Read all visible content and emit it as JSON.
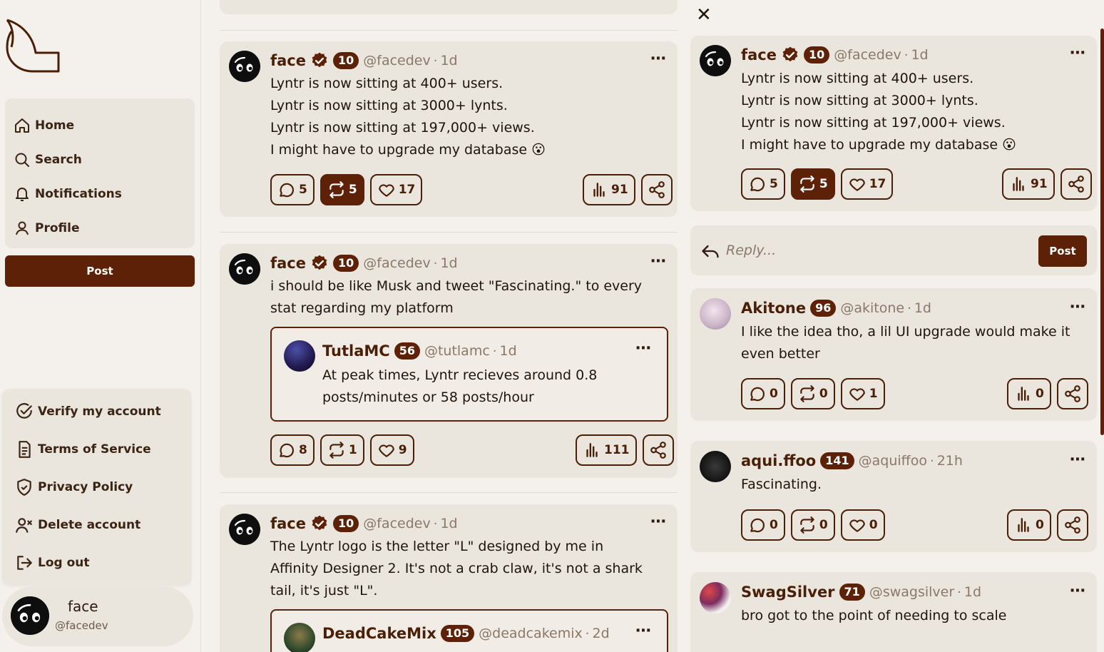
{
  "sidebar": {
    "nav": [
      {
        "label": "Home",
        "icon": "home-icon"
      },
      {
        "label": "Search",
        "icon": "search-icon"
      },
      {
        "label": "Notifications",
        "icon": "bell-icon"
      },
      {
        "label": "Profile",
        "icon": "user-icon"
      }
    ],
    "post_label": "Post",
    "menu": [
      {
        "label": "Verify my account",
        "icon": "verified-check-icon"
      },
      {
        "label": "Terms of Service",
        "icon": "document-icon"
      },
      {
        "label": "Privacy Policy",
        "icon": "shield-check-icon"
      },
      {
        "label": "Delete account",
        "icon": "user-remove-icon"
      },
      {
        "label": "Log out",
        "icon": "logout-icon"
      }
    ],
    "user": {
      "name": "face",
      "handle": "@facedev"
    }
  },
  "feed": {
    "posts": [
      {
        "name": "face",
        "verified": true,
        "level": "10",
        "handle": "@facedev",
        "time": "1d",
        "lines": [
          "Lyntr is now sitting at 400+ users.",
          "Lyntr is now sitting at 3000+ lynts.",
          "Lyntr is now sitting at 197,000+ views.",
          "I might have to upgrade my database 😮"
        ],
        "comments": "5",
        "reposts": "5",
        "likes": "17",
        "views": "91",
        "reposted": true
      },
      {
        "name": "face",
        "verified": true,
        "level": "10",
        "handle": "@facedev",
        "time": "1d",
        "lines": [
          "i should be like Musk and tweet \"Fascinating.\" to every",
          "stat regarding my platform"
        ],
        "quote": {
          "name": "TutlaMC",
          "level": "56",
          "handle": "@tutlamc",
          "time": "1d",
          "lines": [
            "At peak times, Lyntr recieves around 0.8",
            "posts/minutes or 58 posts/hour"
          ]
        },
        "comments": "8",
        "reposts": "1",
        "likes": "9",
        "views": "111"
      },
      {
        "name": "face",
        "verified": true,
        "level": "10",
        "handle": "@facedev",
        "time": "1d",
        "lines": [
          "The Lyntr logo is the letter \"L\" designed by me in",
          "Affinity Designer 2. It's not a crab claw, it's not a shark",
          "tail, it's just \"L\"."
        ],
        "quote": {
          "name": "DeadCakeMix",
          "level": "105",
          "handle": "@deadcakemix",
          "time": "2d"
        }
      }
    ]
  },
  "detail": {
    "close_label": "✕",
    "main": {
      "name": "face",
      "verified": true,
      "level": "10",
      "handle": "@facedev",
      "time": "1d",
      "lines": [
        "Lyntr is now sitting at 400+ users.",
        "Lyntr is now sitting at 3000+ lynts.",
        "Lyntr is now sitting at 197,000+ views.",
        "I might have to upgrade my database 😮"
      ],
      "comments": "5",
      "reposts": "5",
      "likes": "17",
      "views": "91"
    },
    "reply": {
      "placeholder": "Reply...",
      "post_label": "Post"
    },
    "replies": [
      {
        "name": "Akitone",
        "level": "96",
        "handle": "@akitone",
        "time": "1d",
        "lines": [
          "I like the idea tho, a lil UI upgrade would make it",
          "even better"
        ],
        "comments": "0",
        "reposts": "0",
        "likes": "1",
        "views": "0"
      },
      {
        "name": "aqui.ffoo",
        "level": "141",
        "handle": "@aquiffoo",
        "time": "21h",
        "lines": [
          "Fascinating."
        ],
        "comments": "0",
        "reposts": "0",
        "likes": "0",
        "views": "0"
      },
      {
        "name": "SwagSilver",
        "level": "71",
        "handle": "@swagsilver",
        "time": "1d",
        "lines": [
          "bro got to the point of needing to scale"
        ]
      }
    ]
  },
  "colors": {
    "brand": "#5c2106",
    "background": "#f4f1ec",
    "card": "#ebe6dd",
    "muted": "#8a7868"
  }
}
